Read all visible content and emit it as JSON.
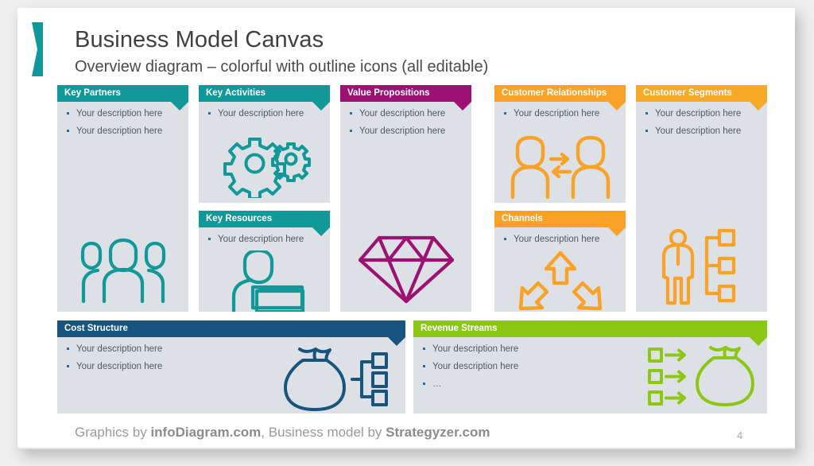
{
  "slide": {
    "title": "Business Model Canvas",
    "subtitle": "Overview diagram – colorful with outline icons (all editable)",
    "page_number": "4",
    "accent_color": "#119999"
  },
  "footer": {
    "prefix": "Graphics by ",
    "brand1": "infoDiagram.com",
    "middle": ", Business model by ",
    "brand2": "Strategyzer.com"
  },
  "colors": {
    "teal": "#119999",
    "magenta": "#9c1273",
    "orange": "#f9a227",
    "amber": "#f7a928",
    "navy": "#17557f",
    "green": "#8cc714",
    "panel_bg": "#dde1e6",
    "bullet": "#2d6ca2",
    "body_text": "#4d5a64"
  },
  "panels": [
    {
      "id": "key-partners",
      "title": "Key Partners",
      "color": "#119999",
      "bullets": [
        "Your description here",
        "Your description here"
      ],
      "icon": "three-people-icon"
    },
    {
      "id": "key-activities",
      "title": "Key Activities",
      "color": "#119999",
      "bullets": [
        "Your description here"
      ],
      "icon": "gears-icon"
    },
    {
      "id": "key-resources",
      "title": "Key Resources",
      "color": "#119999",
      "bullets": [
        "Your description here"
      ],
      "icon": "person-with-book-icon"
    },
    {
      "id": "value-propositions",
      "title": "Value Propositions",
      "color": "#9c1273",
      "bullets": [
        "Your description here",
        "Your description here"
      ],
      "icon": "diamond-icon"
    },
    {
      "id": "customer-relationships",
      "title": "Customer Relationships",
      "color": "#f9a227",
      "bullets": [
        "Your description here"
      ],
      "icon": "two-people-arrows-icon"
    },
    {
      "id": "channels",
      "title": "Channels",
      "color": "#f9a227",
      "bullets": [
        "Your description here"
      ],
      "icon": "three-arrows-icon"
    },
    {
      "id": "customer-segments",
      "title": "Customer Segments",
      "color": "#f7a928",
      "bullets": [
        "Your description here",
        "Your description here"
      ],
      "icon": "person-hierarchy-icon"
    },
    {
      "id": "cost-structure",
      "title": "Cost Structure",
      "color": "#17557f",
      "bullets": [
        "Your description here",
        "Your description here"
      ],
      "icon": "money-bag-tree-icon"
    },
    {
      "id": "revenue-streams",
      "title": "Revenue Streams",
      "color": "#8cc714",
      "bullets": [
        "Your description here",
        "Your description here",
        "…"
      ],
      "icon": "arrows-money-bag-icon"
    }
  ]
}
